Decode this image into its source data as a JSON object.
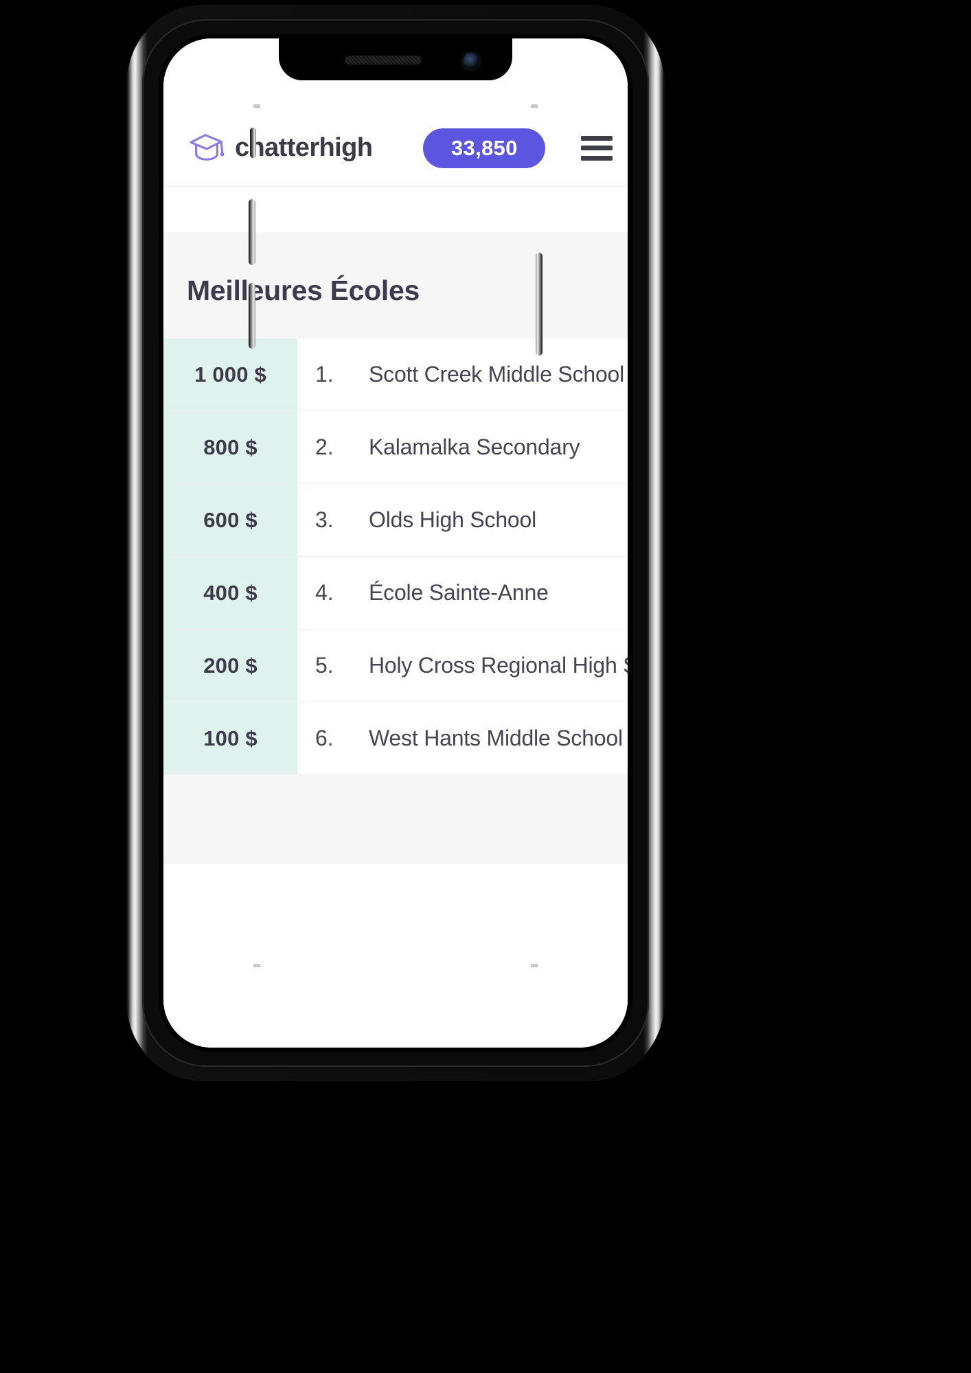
{
  "device": {
    "type": "smartphone-mockup",
    "notch_elements": [
      "speaker-grille",
      "front-camera"
    ],
    "side_buttons": [
      "silent-switch",
      "volume-up",
      "volume-down",
      "power-button"
    ]
  },
  "colors": {
    "brand_purple": "#5b55e0",
    "logo_purple": "#8b78e8",
    "mint_cell": "#dff2ed",
    "panel_grey": "#f6f6f7",
    "text_dark": "#3e3a4d",
    "screen_white": "#ffffff"
  },
  "header": {
    "brand_name": "chatterhigh",
    "logo_icon": "graduation-cap-icon",
    "points_badge": "33,850",
    "menu_icon": "hamburger-menu-icon"
  },
  "main": {
    "page_title": "Meilleures Écoles"
  },
  "leaderboard": {
    "columns": [
      "amount",
      "rank",
      "school"
    ],
    "rows": [
      {
        "amount": "1 000 $",
        "rank": "1.",
        "school": "Scott Creek Middle School"
      },
      {
        "amount": "800 $",
        "rank": "2.",
        "school": "Kalamalka Secondary"
      },
      {
        "amount": "600 $",
        "rank": "3.",
        "school": "Olds High School"
      },
      {
        "amount": "400 $",
        "rank": "4.",
        "school": "École Sainte-Anne"
      },
      {
        "amount": "200 $",
        "rank": "5.",
        "school": "Holy Cross Regional High School"
      },
      {
        "amount": "100 $",
        "rank": "6.",
        "school": "West Hants Middle School"
      }
    ]
  }
}
